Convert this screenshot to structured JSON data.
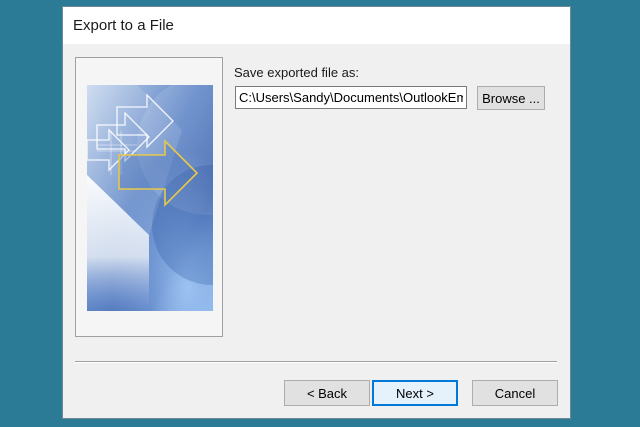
{
  "dialog": {
    "title": "Export to a File",
    "save_label": "Save exported file as:",
    "file_path": "C:\\Users\\Sandy\\Documents\\OutlookEm",
    "browse_label": "Browse ...",
    "back_label": "< Back",
    "next_label": "Next >",
    "cancel_label": "Cancel"
  },
  "colors": {
    "desktop": "#2b7b97",
    "dialog_bg": "#f0f0f0",
    "focus_border": "#0078d7",
    "arrow_outline": "#e8c84a"
  },
  "icons": [
    "wizard-banner-image",
    "export-arrow-icon"
  ]
}
